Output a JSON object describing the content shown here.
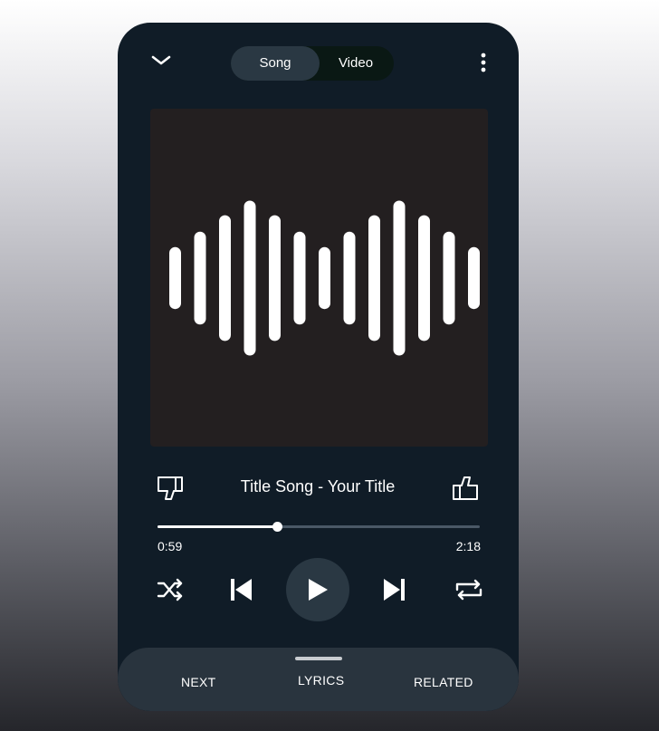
{
  "header": {
    "collapse_icon": "chevron-down-icon",
    "segments": [
      {
        "label": "Song",
        "selected": true
      },
      {
        "label": "Video",
        "selected": false
      }
    ],
    "more_icon": "more-vertical-icon"
  },
  "artwork": {
    "description_icon": "sound-wave-icon",
    "background_color": "#231f20",
    "wave_bar_levels": [
      0.36,
      0.54,
      0.73,
      0.9,
      0.73,
      0.54,
      0.36,
      0.54,
      0.73,
      0.9,
      0.73,
      0.54,
      0.36
    ]
  },
  "now_playing": {
    "title": "Title Song - Your Title",
    "dislike_icon": "thumbs-down-icon",
    "like_icon": "thumbs-up-icon"
  },
  "progress": {
    "elapsed": "0:59",
    "total": "2:18",
    "fraction": 0.37
  },
  "controls": {
    "shuffle_icon": "shuffle-icon",
    "previous_icon": "skip-previous-icon",
    "play_icon": "play-icon",
    "next_icon": "skip-next-icon",
    "repeat_icon": "repeat-icon"
  },
  "bottom_tabs": [
    {
      "label": "NEXT"
    },
    {
      "label": "LYRICS"
    },
    {
      "label": "RELATED"
    }
  ],
  "colors": {
    "phone_background": "#101c27",
    "panel": "#29343e",
    "accent": "#ffffff"
  }
}
